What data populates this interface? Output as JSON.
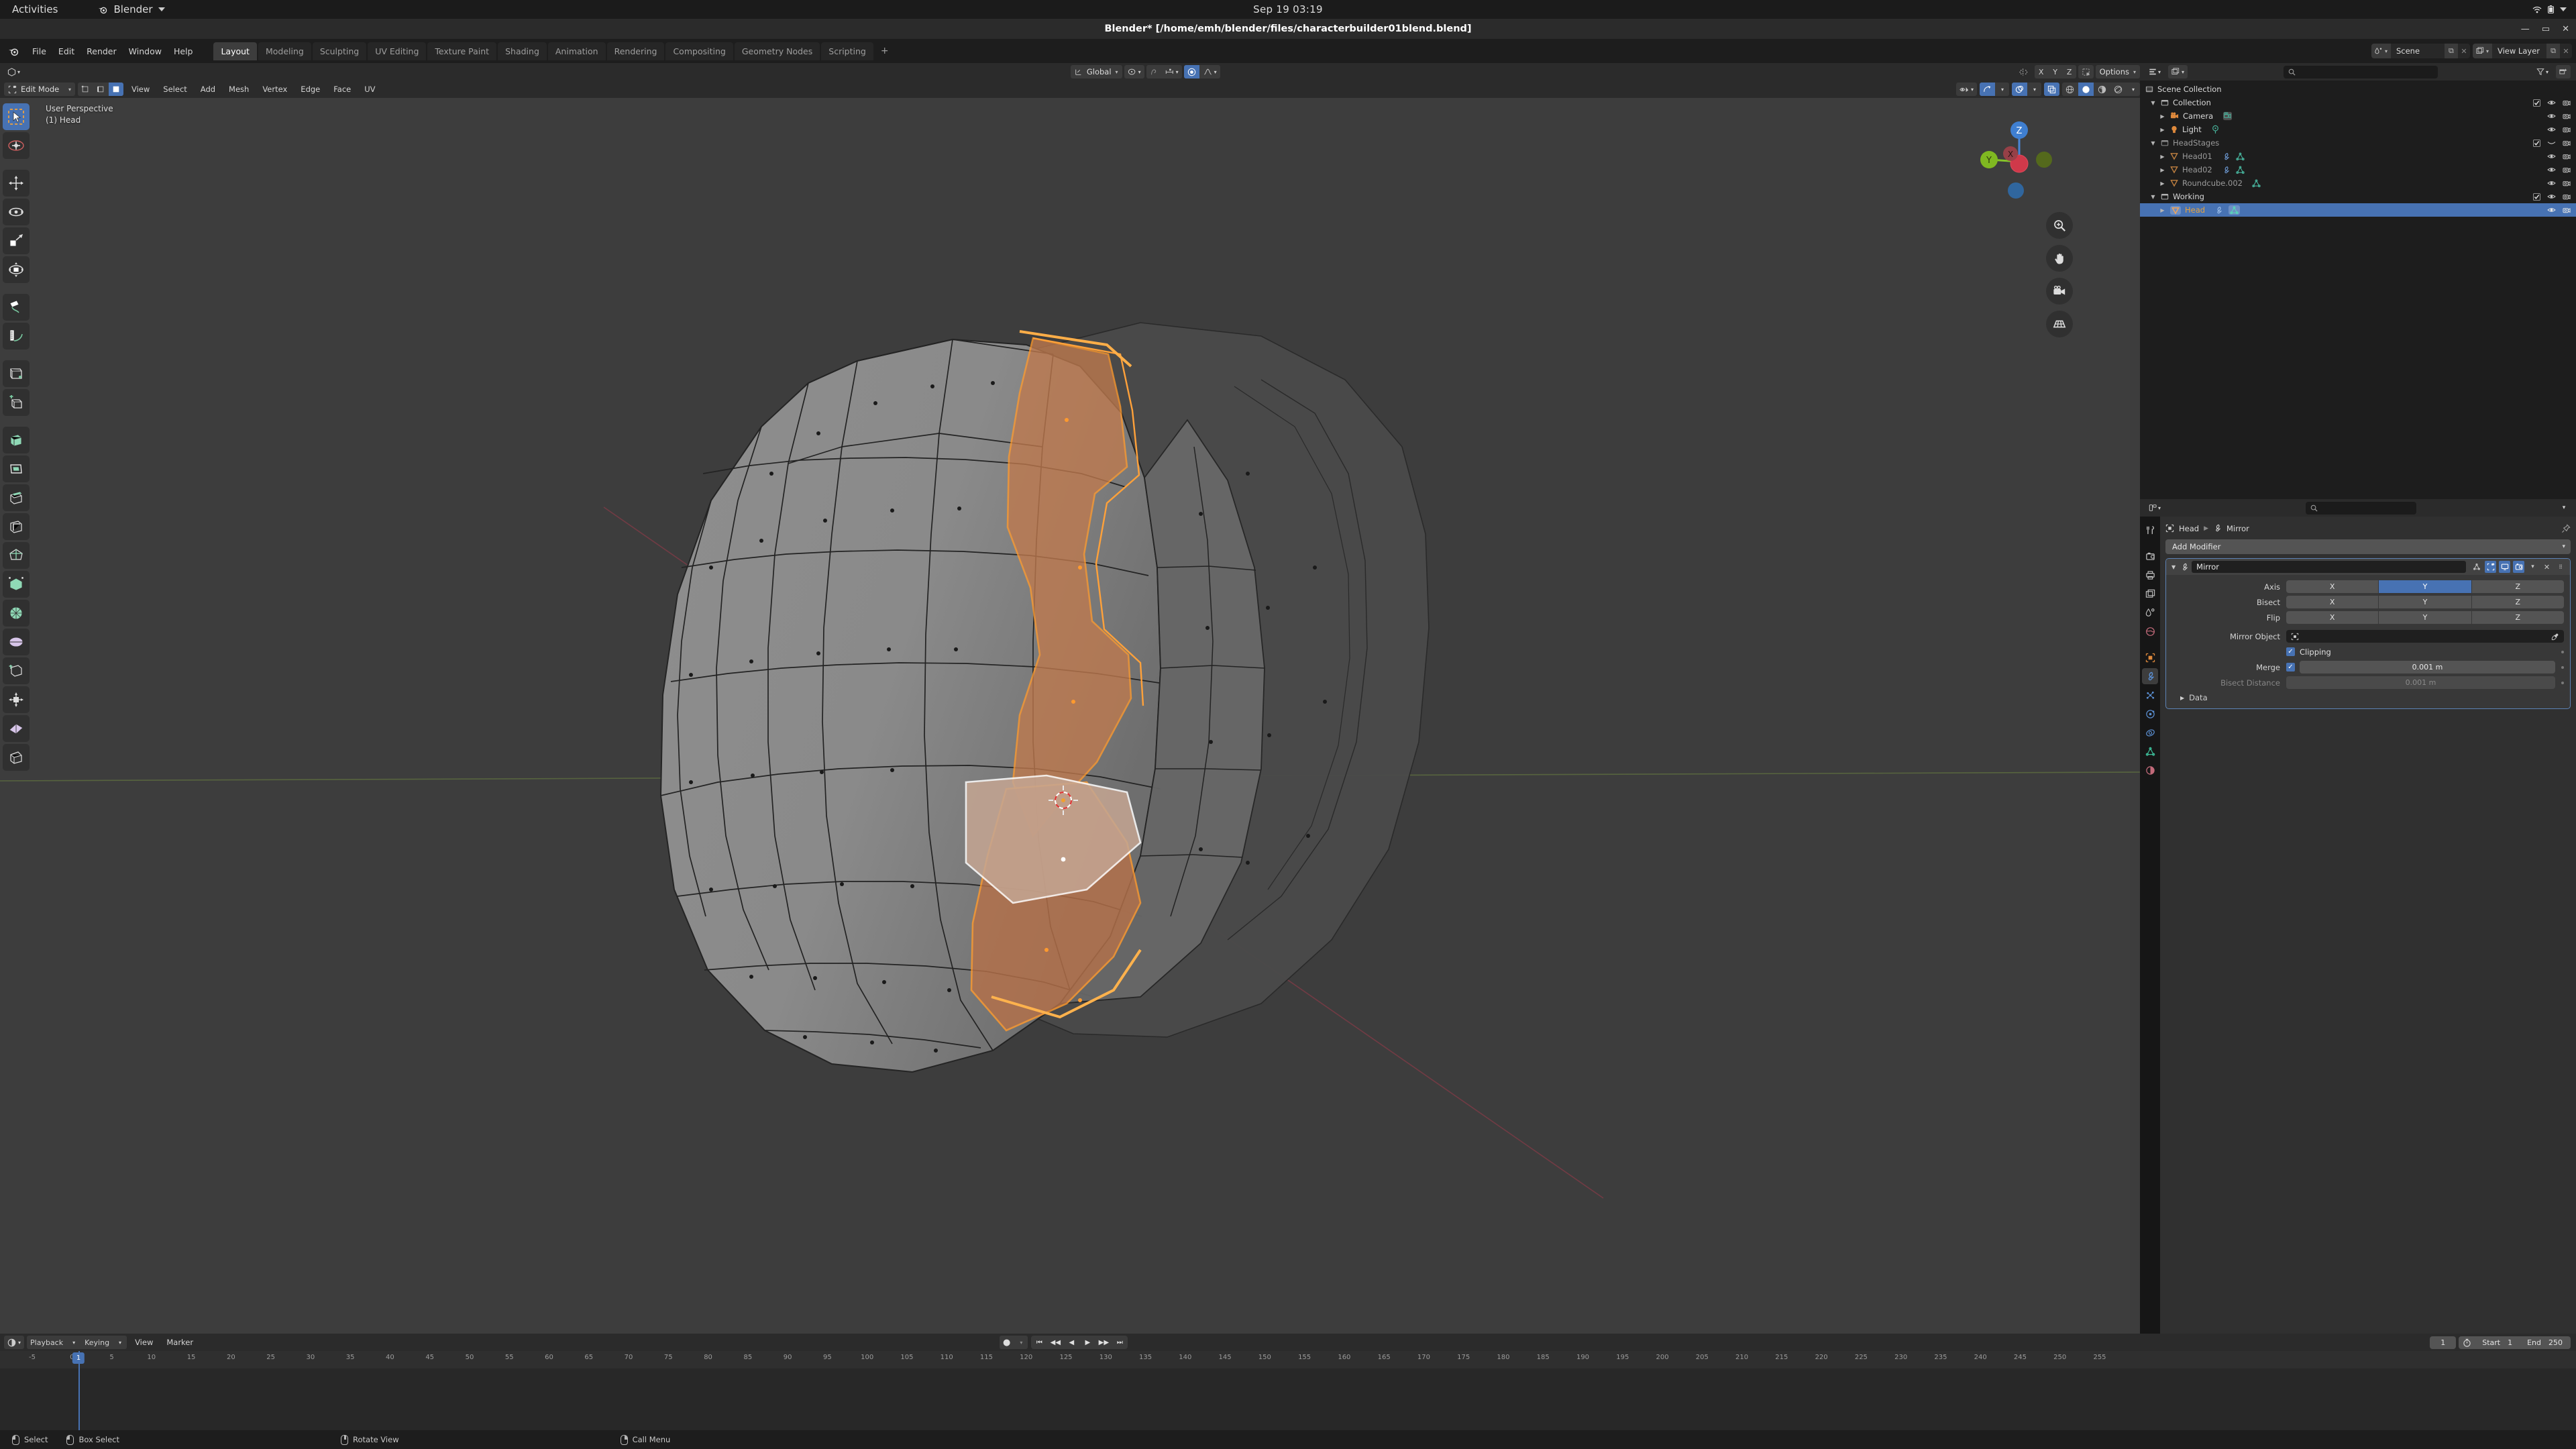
{
  "os_bar": {
    "activities": "Activities",
    "app_name": "Blender",
    "clock": "Sep 19  03:19"
  },
  "window": {
    "title": "Blender* [/home/emh/blender/files/characterbuilder01blend.blend]"
  },
  "topbar": {
    "menus": [
      "File",
      "Edit",
      "Render",
      "Window",
      "Help"
    ],
    "workspaces": [
      "Layout",
      "Modeling",
      "Sculpting",
      "UV Editing",
      "Texture Paint",
      "Shading",
      "Animation",
      "Rendering",
      "Compositing",
      "Geometry Nodes",
      "Scripting"
    ],
    "active_workspace": "Layout",
    "add_workspace": "+",
    "scene_label": "Scene",
    "viewlayer_label": "View Layer"
  },
  "viewport": {
    "mode": "Edit Mode",
    "menus": [
      "View",
      "Select",
      "Add",
      "Mesh",
      "Vertex",
      "Edge",
      "Face",
      "UV"
    ],
    "transform_orientation": "Global",
    "options_label": "Options",
    "proportional_axes": [
      "X",
      "Y",
      "Z"
    ],
    "overlay_line1": "User Perspective",
    "overlay_line2": "(1) Head",
    "gizmo_axes": {
      "x": "X",
      "y": "Y",
      "z": "Z"
    }
  },
  "outliner": {
    "display_mode_icon": "view-layer-icon",
    "search_placeholder": "",
    "rows": [
      {
        "label": "Scene Collection",
        "indent": 0,
        "icon": "scene-collection-icon",
        "disclosure": "",
        "dim": false,
        "selected": false,
        "checkbox": false,
        "eye": false,
        "camera": false
      },
      {
        "label": "Collection",
        "indent": 1,
        "icon": "collection-icon",
        "disclosure": "▼",
        "dim": false,
        "selected": false,
        "checkbox": true,
        "eye": true,
        "camera": true
      },
      {
        "label": "Camera",
        "indent": 2,
        "icon": "camera-object-icon",
        "disclosure": "▶",
        "dim": false,
        "selected": false,
        "checkbox": false,
        "eye": true,
        "camera": true,
        "extra": "camera-data-icon"
      },
      {
        "label": "Light",
        "indent": 2,
        "icon": "light-object-icon",
        "disclosure": "▶",
        "dim": false,
        "selected": false,
        "checkbox": false,
        "eye": true,
        "camera": true,
        "extra": "light-data-icon"
      },
      {
        "label": "HeadStages",
        "indent": 1,
        "icon": "collection-icon",
        "disclosure": "▼",
        "dim": true,
        "selected": false,
        "checkbox": true,
        "eye": "closed",
        "camera": true
      },
      {
        "label": "Head01",
        "indent": 2,
        "icon": "mesh-object-icon",
        "disclosure": "▶",
        "dim": true,
        "selected": false,
        "checkbox": false,
        "eye": true,
        "camera": true,
        "extra": "modifier-icon,mesh-data-icon"
      },
      {
        "label": "Head02",
        "indent": 2,
        "icon": "mesh-object-icon",
        "disclosure": "▶",
        "dim": true,
        "selected": false,
        "checkbox": false,
        "eye": true,
        "camera": true,
        "extra": "modifier-icon,mesh-data-icon"
      },
      {
        "label": "Roundcube.002",
        "indent": 2,
        "icon": "mesh-object-icon",
        "disclosure": "▶",
        "dim": true,
        "selected": false,
        "checkbox": false,
        "eye": true,
        "camera": true,
        "extra": "mesh-data-icon"
      },
      {
        "label": "Working",
        "indent": 1,
        "icon": "collection-icon",
        "disclosure": "▼",
        "dim": false,
        "selected": false,
        "checkbox": true,
        "eye": true,
        "camera": true
      },
      {
        "label": "Head",
        "indent": 2,
        "icon": "mesh-object-icon",
        "disclosure": "▶",
        "dim": false,
        "selected": true,
        "checkbox": false,
        "eye": true,
        "camera": true,
        "extra": "modifier-icon,mesh-data-icon"
      }
    ]
  },
  "properties": {
    "search_placeholder": "",
    "breadcrumb": [
      "Head",
      "Mirror"
    ],
    "add_modifier_label": "Add Modifier",
    "modifier": {
      "name": "Mirror",
      "rows": [
        {
          "label": "Axis",
          "type": "segment",
          "options": [
            "X",
            "Y",
            "Z"
          ],
          "active": "Y"
        },
        {
          "label": "Bisect",
          "type": "segment",
          "options": [
            "X",
            "Y",
            "Z"
          ],
          "active": ""
        },
        {
          "label": "Flip",
          "type": "segment",
          "options": [
            "X",
            "Y",
            "Z"
          ],
          "active": ""
        }
      ],
      "mirror_object_label": "Mirror Object",
      "mirror_object_value": "",
      "clipping_label": "Clipping",
      "clipping_checked": true,
      "merge_label": "Merge",
      "merge_checked": true,
      "merge_value": "0.001 m",
      "bisect_distance_label": "Bisect Distance",
      "bisect_distance_value": "0.001 m",
      "data_label": "Data"
    }
  },
  "timeline": {
    "editor_icon": "timeline-icon",
    "menus": [
      "Playback",
      "Keying",
      "View",
      "Marker"
    ],
    "current_frame": "1",
    "start_label": "Start",
    "start_value": "1",
    "end_label": "End",
    "end_value": "250",
    "ticks": [
      "-5",
      "0",
      "5",
      "10",
      "15",
      "20",
      "25",
      "30",
      "35",
      "40",
      "45",
      "50",
      "55",
      "60",
      "65",
      "70",
      "75",
      "80",
      "85",
      "90",
      "95",
      "100",
      "105",
      "110",
      "115",
      "120",
      "125",
      "130",
      "135",
      "140",
      "145",
      "150",
      "155",
      "160",
      "165",
      "170",
      "175",
      "180",
      "185",
      "190",
      "195",
      "200",
      "205",
      "210",
      "215",
      "220",
      "225",
      "230",
      "235",
      "240",
      "245",
      "250",
      "255"
    ],
    "playhead_label": "1"
  },
  "statusbar": {
    "items": [
      {
        "mouse": "left",
        "label": "Select"
      },
      {
        "mouse": "left-drag",
        "label": "Box Select"
      },
      {
        "mouse": "middle",
        "label": "Rotate View"
      },
      {
        "mouse": "right",
        "label": "Call Menu"
      }
    ]
  },
  "colors": {
    "accent_blue": "#4772b3",
    "selection_orange": "#e8913c",
    "mesh_grey": "#8b8b8b",
    "viewport_bg": "#3d3d3d",
    "panel_bg": "#303030",
    "header_bg": "#2b2b2b"
  }
}
